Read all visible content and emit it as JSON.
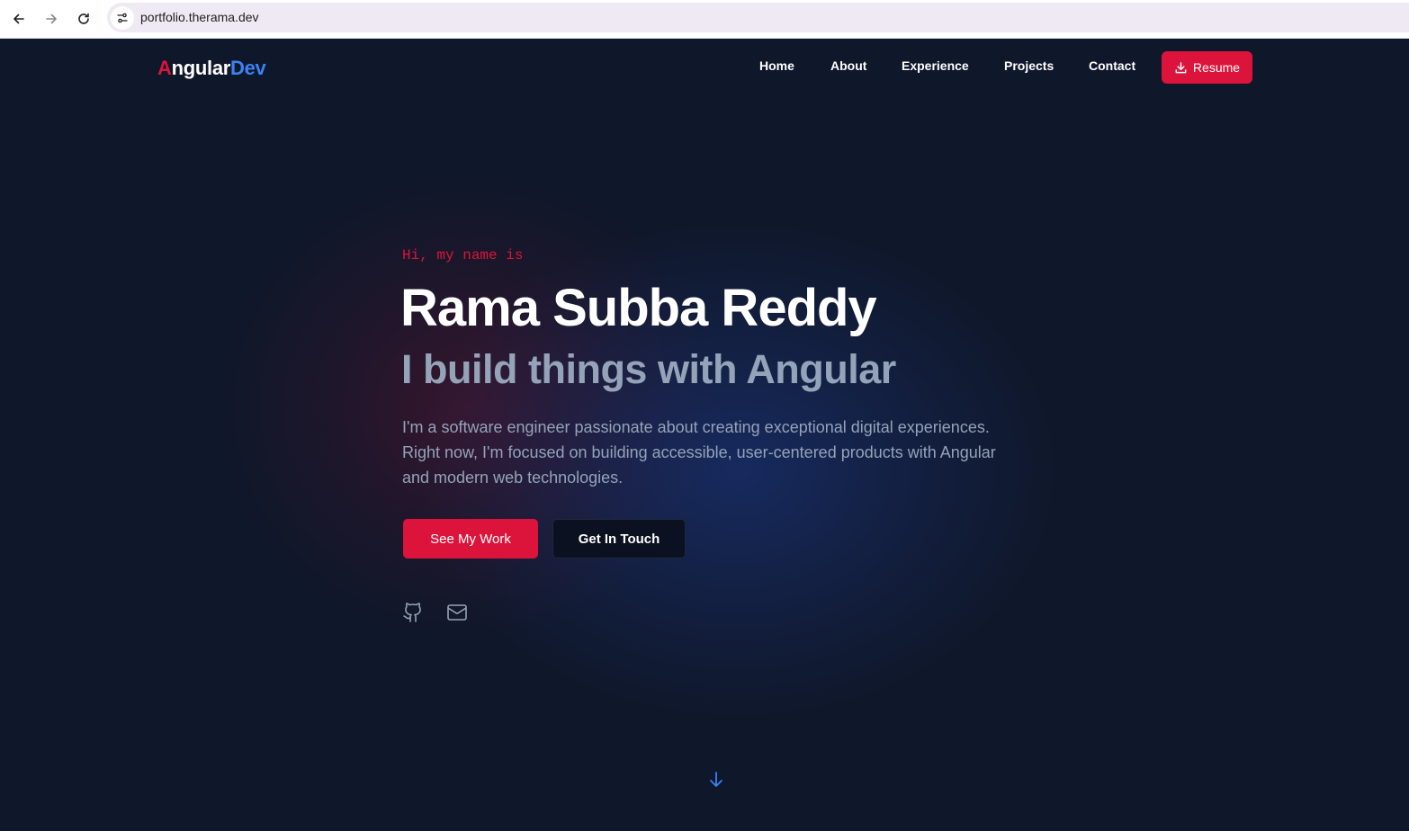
{
  "browser": {
    "url": "portfolio.therama.dev",
    "back_icon": "arrow-left-icon",
    "forward_icon": "arrow-right-icon",
    "reload_icon": "reload-icon",
    "site_info_icon": "tune-icon"
  },
  "header": {
    "logo": {
      "first_letter": "A",
      "rest": "ngular",
      "suffix": "Dev"
    },
    "nav": [
      {
        "label": "Home"
      },
      {
        "label": "About"
      },
      {
        "label": "Experience"
      },
      {
        "label": "Projects"
      },
      {
        "label": "Contact"
      }
    ],
    "resume": {
      "label": "Resume",
      "icon": "download-icon"
    }
  },
  "hero": {
    "intro": "Hi, my name is",
    "name": "Rama Subba Reddy",
    "tagline": "I build things with Angular",
    "description": "I'm a software engineer passionate about creating exceptional digital experiences. Right now, I'm focused on building accessible, user-centered products with Angular and modern web technologies.",
    "primary_button": "See My Work",
    "secondary_button": "Get In Touch",
    "social": [
      {
        "icon": "github-icon"
      },
      {
        "icon": "mail-icon"
      }
    ],
    "scroll_icon": "arrow-down-icon"
  },
  "colors": {
    "background": "#0f172a",
    "accent_red": "#dc143c",
    "accent_blue": "#3b82f6",
    "muted_text": "#94a3b8",
    "white": "#ffffff"
  }
}
